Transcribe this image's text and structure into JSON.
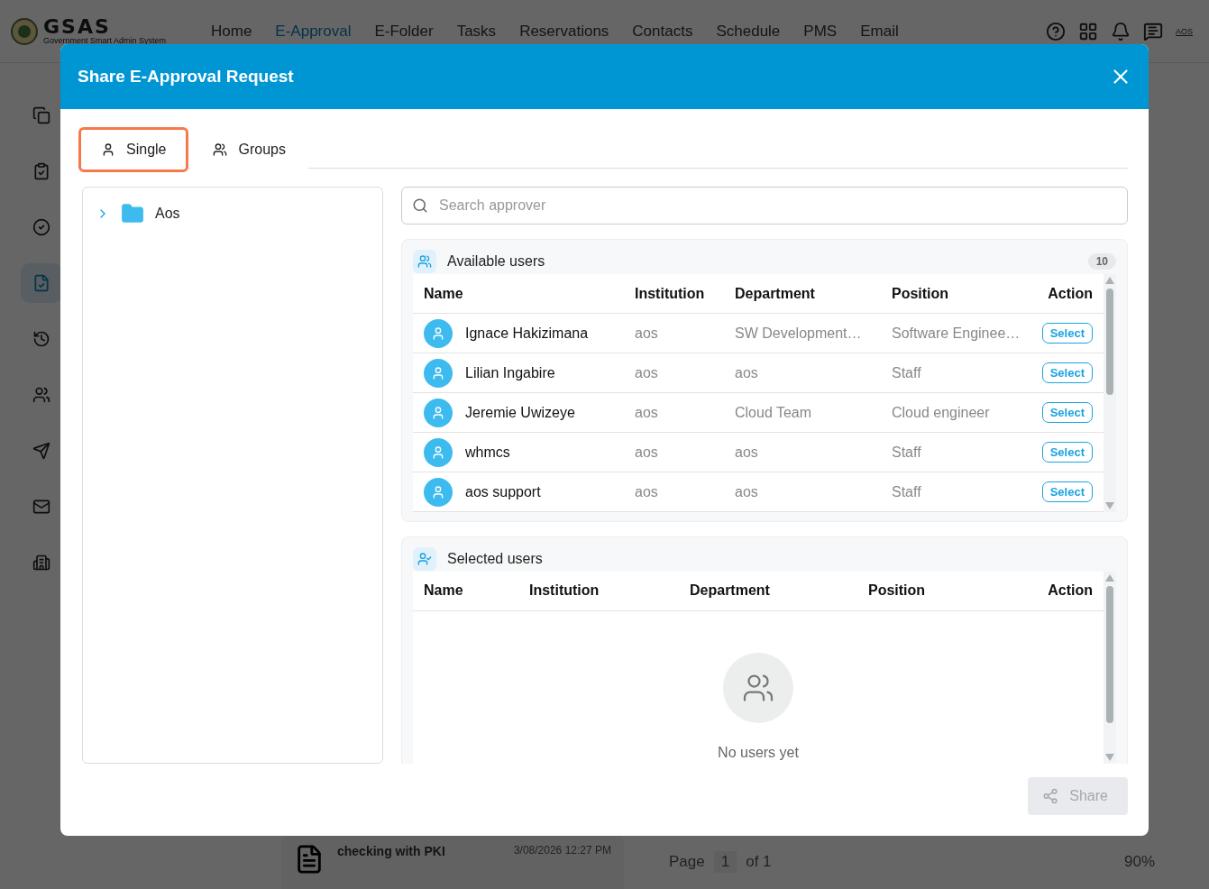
{
  "header": {
    "logo": {
      "name": "GSAS",
      "subtitle": "Government Smart Admin System"
    },
    "nav": [
      {
        "label": "Home",
        "selected": false
      },
      {
        "label": "E-Approval",
        "selected": true
      },
      {
        "label": "E-Folder",
        "selected": false
      },
      {
        "label": "Tasks",
        "selected": false
      },
      {
        "label": "Reservations",
        "selected": false
      },
      {
        "label": "Contacts",
        "selected": false
      },
      {
        "label": "Schedule",
        "selected": false
      },
      {
        "label": "PMS",
        "selected": false
      },
      {
        "label": "Email",
        "selected": false
      }
    ],
    "user_badge": "AOS"
  },
  "sidebar": {
    "items": [
      {
        "kind": "copy",
        "selected": false
      },
      {
        "kind": "clipboard",
        "selected": false
      },
      {
        "kind": "check",
        "selected": false
      },
      {
        "kind": "approval",
        "selected": true
      },
      {
        "kind": "history",
        "selected": false
      },
      {
        "kind": "people",
        "selected": false
      },
      {
        "kind": "send",
        "selected": false
      },
      {
        "kind": "mail",
        "selected": false
      },
      {
        "kind": "building",
        "selected": false
      }
    ]
  },
  "background": {
    "document": {
      "title": "checking with PKI",
      "date": "3/08/2026 12:27 PM"
    },
    "pager": {
      "label": "Page",
      "page": "1",
      "of": "of 1",
      "zoom": "90%"
    }
  },
  "dialog": {
    "title": "Share E-Approval Request",
    "tabs": [
      {
        "kind": "single",
        "label": "Single",
        "selected": true
      },
      {
        "kind": "groups",
        "label": "Groups",
        "selected": false
      }
    ],
    "tree": [
      {
        "label": "Aos",
        "expanded": false
      }
    ],
    "search": {
      "placeholder": "Search approver"
    },
    "available": {
      "title": "Available users",
      "count": "10",
      "columns": [
        "Name",
        "Institution",
        "Department",
        "Position",
        "Action"
      ],
      "rows": [
        {
          "name": "Ignace Hakizimana",
          "institution": "aos",
          "department": "SW Development…",
          "position": "Software Enginee…",
          "action": "Select"
        },
        {
          "name": "Lilian Ingabire",
          "institution": "aos",
          "department": "aos",
          "position": "Staff",
          "action": "Select"
        },
        {
          "name": "Jeremie Uwizeye",
          "institution": "aos",
          "department": "Cloud Team",
          "position": "Cloud engineer",
          "action": "Select"
        },
        {
          "name": "whmcs",
          "institution": "aos",
          "department": "aos",
          "position": "Staff",
          "action": "Select"
        },
        {
          "name": "aos support",
          "institution": "aos",
          "department": "aos",
          "position": "Staff",
          "action": "Select"
        }
      ]
    },
    "selected": {
      "title": "Selected users",
      "columns": [
        "Name",
        "Institution",
        "Department",
        "Position",
        "Action"
      ],
      "empty": "No users yet"
    },
    "share_button": {
      "label": "Share",
      "disabled": true
    }
  }
}
